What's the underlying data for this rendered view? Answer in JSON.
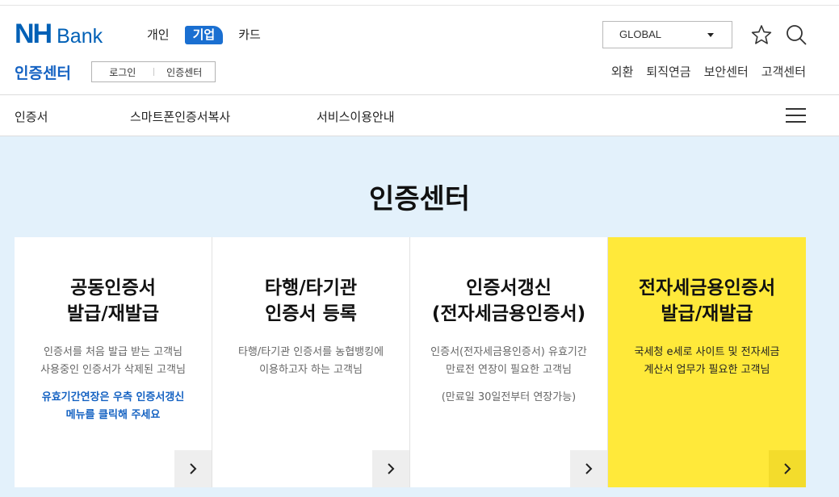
{
  "header": {
    "logo_nh": "NH",
    "logo_bank": "Bank",
    "segments": [
      {
        "label": "개인",
        "active": false
      },
      {
        "label": "기업",
        "active": true
      },
      {
        "label": "카드",
        "active": false
      }
    ],
    "global_select": "GLOBAL",
    "sub_title": "인증센터",
    "login_label": "로그인",
    "cert_center_label": "인증센터",
    "util_links": [
      "외환",
      "퇴직연금",
      "보안센터",
      "고객센터"
    ],
    "icons": [
      "star-icon",
      "search-icon"
    ]
  },
  "menu": {
    "items": [
      "인증서",
      "스마트폰인증서복사",
      "서비스이용안내"
    ],
    "icon": "hamburger-menu-icon"
  },
  "main": {
    "title": "인증센터",
    "cards": [
      {
        "title_line1": "공동인증서",
        "title_line2": "발급/재발급",
        "desc_line1": "인증서를 처음 발급 받는 고객님",
        "desc_line2": "사용중인 인증서가 삭제된 고객님",
        "note_line1": "유효기간연장은 우측 인증서갱신",
        "note_line2": "메뉴를 클릭해 주세요"
      },
      {
        "title_line1": "타행/타기관",
        "title_line2": "인증서 등록",
        "desc_line1": "타행/타기관 인증서를 농협뱅킹에",
        "desc_line2": "이용하고자 하는 고객님"
      },
      {
        "title_line1": "인증서갱신",
        "title_line2": "(전자세금용인증서)",
        "desc_line1": "인증서(전자세금용인증서) 유효기간",
        "desc_line2": "만료전 연장이 필요한 고객님",
        "note": "(만료일 30일전부터 연장가능)"
      },
      {
        "title_line1": "전자세금용인증서",
        "title_line2": "발급/재발급",
        "desc_line1": "국세청 e세로 사이트 및 전자세금",
        "desc_line2": "계산서 업무가 필요한 고객님"
      }
    ]
  },
  "colors": {
    "brand_blue": "#0060b6",
    "accent_blue": "#1a6fd1",
    "main_bg": "#e3f1fb",
    "highlight_yellow": "#ffe93a"
  }
}
